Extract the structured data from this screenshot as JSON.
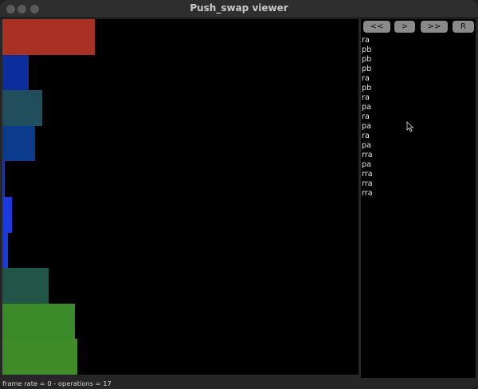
{
  "window": {
    "title": "Push_swap viewer"
  },
  "colors": {
    "background": "#000000",
    "window": "#262626",
    "button": "#8a8a8a"
  },
  "stack_a": [
    {
      "value": 7,
      "color": "#a93124"
    },
    {
      "value": 2,
      "color": "#0c2e9c"
    },
    {
      "value": 3,
      "color": "#204e5c"
    },
    {
      "value": 2.5,
      "color": "#0c3a8c"
    },
    {
      "value": 0.2,
      "color": "#0d2ff0"
    },
    {
      "value": 0.7,
      "color": "#1a3ae0"
    },
    {
      "value": 0.4,
      "color": "#1a3ae0"
    },
    {
      "value": 3.5,
      "color": "#215548"
    },
    {
      "value": 5.5,
      "color": "#3b8a2a"
    },
    {
      "value": 5.7,
      "color": "#3f8b28"
    }
  ],
  "stack_a_max": 27,
  "controls": [
    {
      "name": "first-frame-button",
      "label": "<<"
    },
    {
      "name": "next-frame-button",
      "label": ">"
    },
    {
      "name": "last-frame-button",
      "label": ">>"
    },
    {
      "name": "reset-button",
      "label": "R"
    }
  ],
  "operations": [
    "ra",
    "pb",
    "pb",
    "pb",
    "ra",
    "pb",
    "ra",
    "pa",
    "ra",
    "pa",
    "ra",
    "pa",
    "rra",
    "pa",
    "rra",
    "rra",
    "rra"
  ],
  "status": {
    "text": "frame rate = 0  - operations = 17"
  }
}
